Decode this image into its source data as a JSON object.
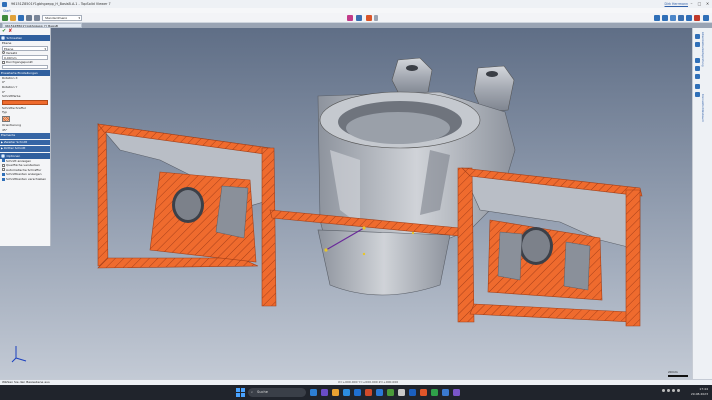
{
  "window": {
    "title": "96151Z8501Y1gbhgzepp_H_BasisB.A.1 - TopSolid Viewer 7",
    "user": "Dirk Herrmann"
  },
  "menubar": {
    "start_label": "Start"
  },
  "toolbar": {
    "view_select": "Standardmenü"
  },
  "document_tab": {
    "label": "96151Z8501Y1gbhgzepp_H_BasisB"
  },
  "panel": {
    "section_title": "Schneiden",
    "element_label": "Ebene",
    "element_value": "Ebene",
    "mode_label": "Versatz",
    "offset_value": "0,00mm",
    "checkbox_label": "Durchgangspunkt",
    "advanced_title": "Erweiterte Einstellungen",
    "rotation_x_label": "Rotation X",
    "rotation_x_value": "0°",
    "rotation_y_label": "Rotation Y",
    "rotation_y_value": "0°",
    "fill_color_label": "Schnittfarbe",
    "hatch_color_label": "Schnittschraffur",
    "type_label": "Typ",
    "rotation_label": "Orientierung",
    "rotation_value": "45°",
    "elements_header": "Elemente",
    "prev_cut_label": "Zweiter Schnitt",
    "third_cut_label": "Dritter Schnitt",
    "options_header": "Optionen",
    "opt1": "Schnitt anzeigen",
    "opt2": "Querfläche verstecken",
    "opt3": "Automatische Schraffur",
    "opt4": "Schnittkanten anzeigen",
    "opt5": "Schnittkanten verschieben"
  },
  "right_bar": {
    "tab1": "Abwickelbarkeitsprüfung",
    "tab2": "Konnektivitätsbaum"
  },
  "scale": {
    "label": "20mm"
  },
  "status": {
    "message": "Wählen Sie den Basisebene aus",
    "coords": "X=+000.000   Y=+000.000   Z=+000.000"
  },
  "taskbar": {
    "search_label": "Suche",
    "time": "17:44",
    "date": "29.08.2023"
  },
  "colors": {
    "section_fill": "#ef6b2e",
    "header_blue": "#2f5f9e",
    "part_metal": "#b7bcc4"
  }
}
